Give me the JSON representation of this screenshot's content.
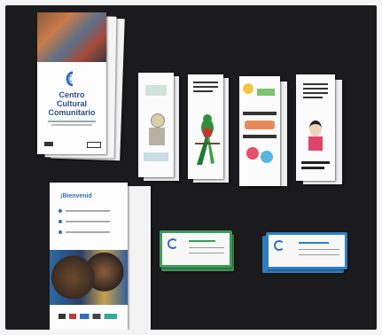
{
  "brochure_center": {
    "title": "Centro Cultural Comunitario"
  },
  "brochure_welcome": {
    "heading": "¡Bienvenid"
  },
  "colors": {
    "table": "#1b1a1c",
    "brand_blue": "#2f4e86",
    "card_green": "#3f9a5a",
    "card_blue": "#2f7fc4"
  }
}
